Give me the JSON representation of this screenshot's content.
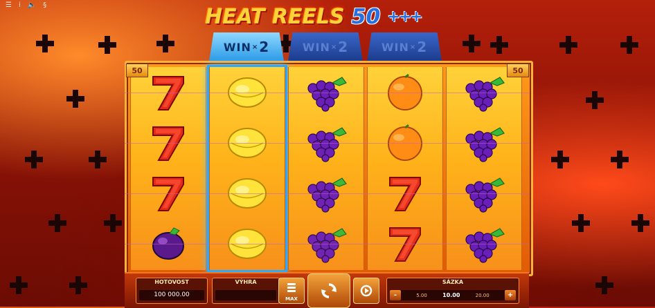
{
  "topbar": {
    "icons": [
      "menu-icon",
      "info-icon",
      "sound-icon",
      "currency-icon"
    ],
    "glyphs": [
      "☰",
      "i",
      "🔈",
      "§"
    ]
  },
  "logo": {
    "main": "HEAT REELS",
    "number": "50",
    "plus": "+++"
  },
  "paylines": {
    "left": "50",
    "right": "50"
  },
  "reels": [
    {
      "multiplier_label": null,
      "symbols": [
        "seven",
        "seven",
        "seven",
        "plum"
      ]
    },
    {
      "multiplier_label": "WIN",
      "multiplier_value": "2",
      "active": true,
      "symbols": [
        "lemon",
        "lemon",
        "lemon",
        "lemon"
      ]
    },
    {
      "multiplier_label": "WIN",
      "multiplier_value": "2",
      "active": false,
      "symbols": [
        "grapes",
        "grapes",
        "grapes",
        "grapes"
      ]
    },
    {
      "multiplier_label": "WIN",
      "multiplier_value": "2",
      "active": false,
      "symbols": [
        "orange",
        "orange",
        "seven",
        "seven"
      ]
    },
    {
      "multiplier_label": null,
      "symbols": [
        "grapes",
        "grapes",
        "grapes",
        "grapes"
      ]
    }
  ],
  "win_heads": [
    {
      "text": "WIN",
      "x": "×",
      "mult": "2"
    },
    {
      "text": "WIN",
      "x": "×",
      "mult": "2"
    },
    {
      "text": "WIN",
      "x": "×",
      "mult": "2"
    }
  ],
  "bottom": {
    "balance_label": "HOTOVOST",
    "balance_value": "100 000.00",
    "win_label": "VÝHRA",
    "win_value": "",
    "max_label": "MAX",
    "stake_label": "SÁZKA",
    "stake_minus": "-",
    "stake_plus": "+",
    "stake_options": [
      "5.00",
      "10.00",
      "20.00"
    ],
    "stake_selected": "10.00"
  },
  "colors": {
    "active_reel_glow": "#2ea8ff",
    "logo_gold": "#ffd23a",
    "logo_blue": "#2a6fe0"
  }
}
